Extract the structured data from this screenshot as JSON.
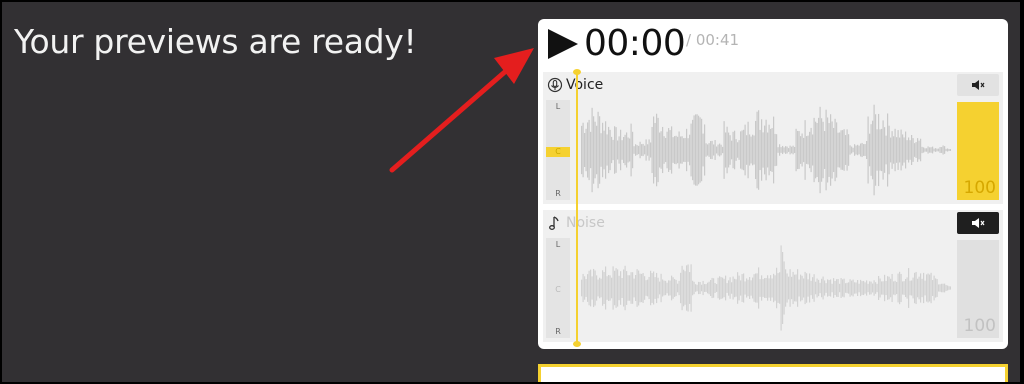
{
  "heading": "Your previews are ready!",
  "player": {
    "current_time": "00:00",
    "total_time": "/ 00:41",
    "play_icon": "play-icon"
  },
  "tracks": [
    {
      "name": "Voice",
      "icon": "microphone-icon",
      "pan": {
        "left": "L",
        "center": "C",
        "right": "R"
      },
      "mute_icon": "speaker-mute-icon",
      "muted": false,
      "volume": "100"
    },
    {
      "name": "Noise",
      "icon": "music-note-icon",
      "pan": {
        "left": "L",
        "center": "C",
        "right": "R"
      },
      "mute_icon": "speaker-mute-icon",
      "muted": true,
      "volume": "100"
    }
  ],
  "colors": {
    "background": "#323033",
    "accent": "#f5d130",
    "waveform": "#c9c9c9",
    "text": "#111111"
  }
}
